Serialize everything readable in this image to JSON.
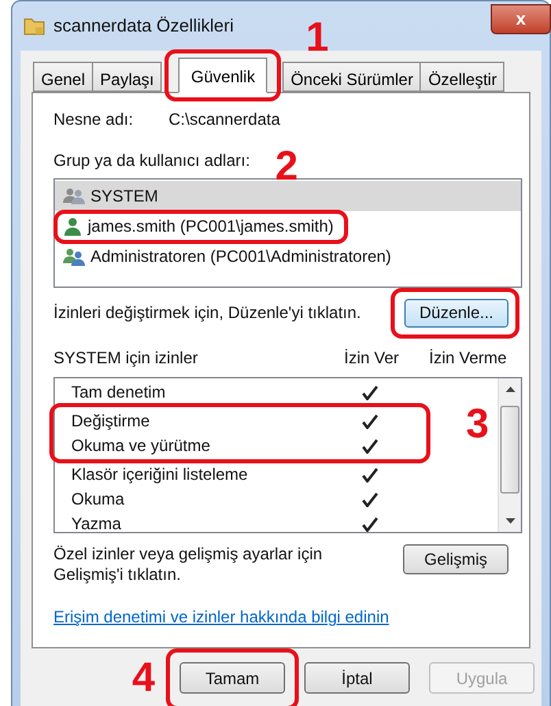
{
  "window": {
    "title": "scannerdata Özellikleri",
    "close_label": "x"
  },
  "tabs": [
    {
      "label": "Genel",
      "selected": false
    },
    {
      "label": "Paylaşı",
      "selected": false
    },
    {
      "label": "Güvenlik",
      "selected": true
    },
    {
      "label": "Önceki Sürümler",
      "selected": false
    },
    {
      "label": "Özelleştir",
      "selected": false
    }
  ],
  "object_name": {
    "label": "Nesne adı:",
    "value": "C:\\scannerdata"
  },
  "principals": {
    "label": "Grup ya da kullanıcı adları:",
    "items": [
      {
        "kind": "system",
        "name": "SYSTEM",
        "selected": true
      },
      {
        "kind": "user",
        "name": "james.smith (PC001\\james.smith)",
        "selected": false
      },
      {
        "kind": "group",
        "name": "Administratoren (PC001\\Administratoren)",
        "selected": false
      }
    ]
  },
  "edit_hint": "İzinleri değiştirmek için, Düzenle'yi tıklatın.",
  "edit_button": "Düzenle...",
  "permissions": {
    "title": "SYSTEM için izinler",
    "allow_header": "İzin Ver",
    "deny_header": "İzin Verme",
    "rows": [
      {
        "name": "Tam denetim",
        "allow": true
      },
      {
        "name": "Değiştirme",
        "allow": true
      },
      {
        "name": "Okuma ve yürütme",
        "allow": true
      },
      {
        "name": "Klasör içeriğini listeleme",
        "allow": true
      },
      {
        "name": "Okuma",
        "allow": true
      },
      {
        "name": "Yazma",
        "allow": true
      }
    ]
  },
  "advanced_hint": "Özel izinler veya gelişmiş ayarlar için Gelişmiş'i tıklatın.",
  "advanced_button": "Gelişmiş",
  "help_link": "Erişim denetimi ve izinler hakkında bilgi edinin",
  "buttons": [
    {
      "label": "Tamam",
      "disabled": false
    },
    {
      "label": "İptal",
      "disabled": false
    },
    {
      "label": "Uygula",
      "disabled": true
    }
  ],
  "annotations": [
    {
      "number": "1"
    },
    {
      "number": "2"
    },
    {
      "number": "3"
    },
    {
      "number": "4"
    }
  ]
}
